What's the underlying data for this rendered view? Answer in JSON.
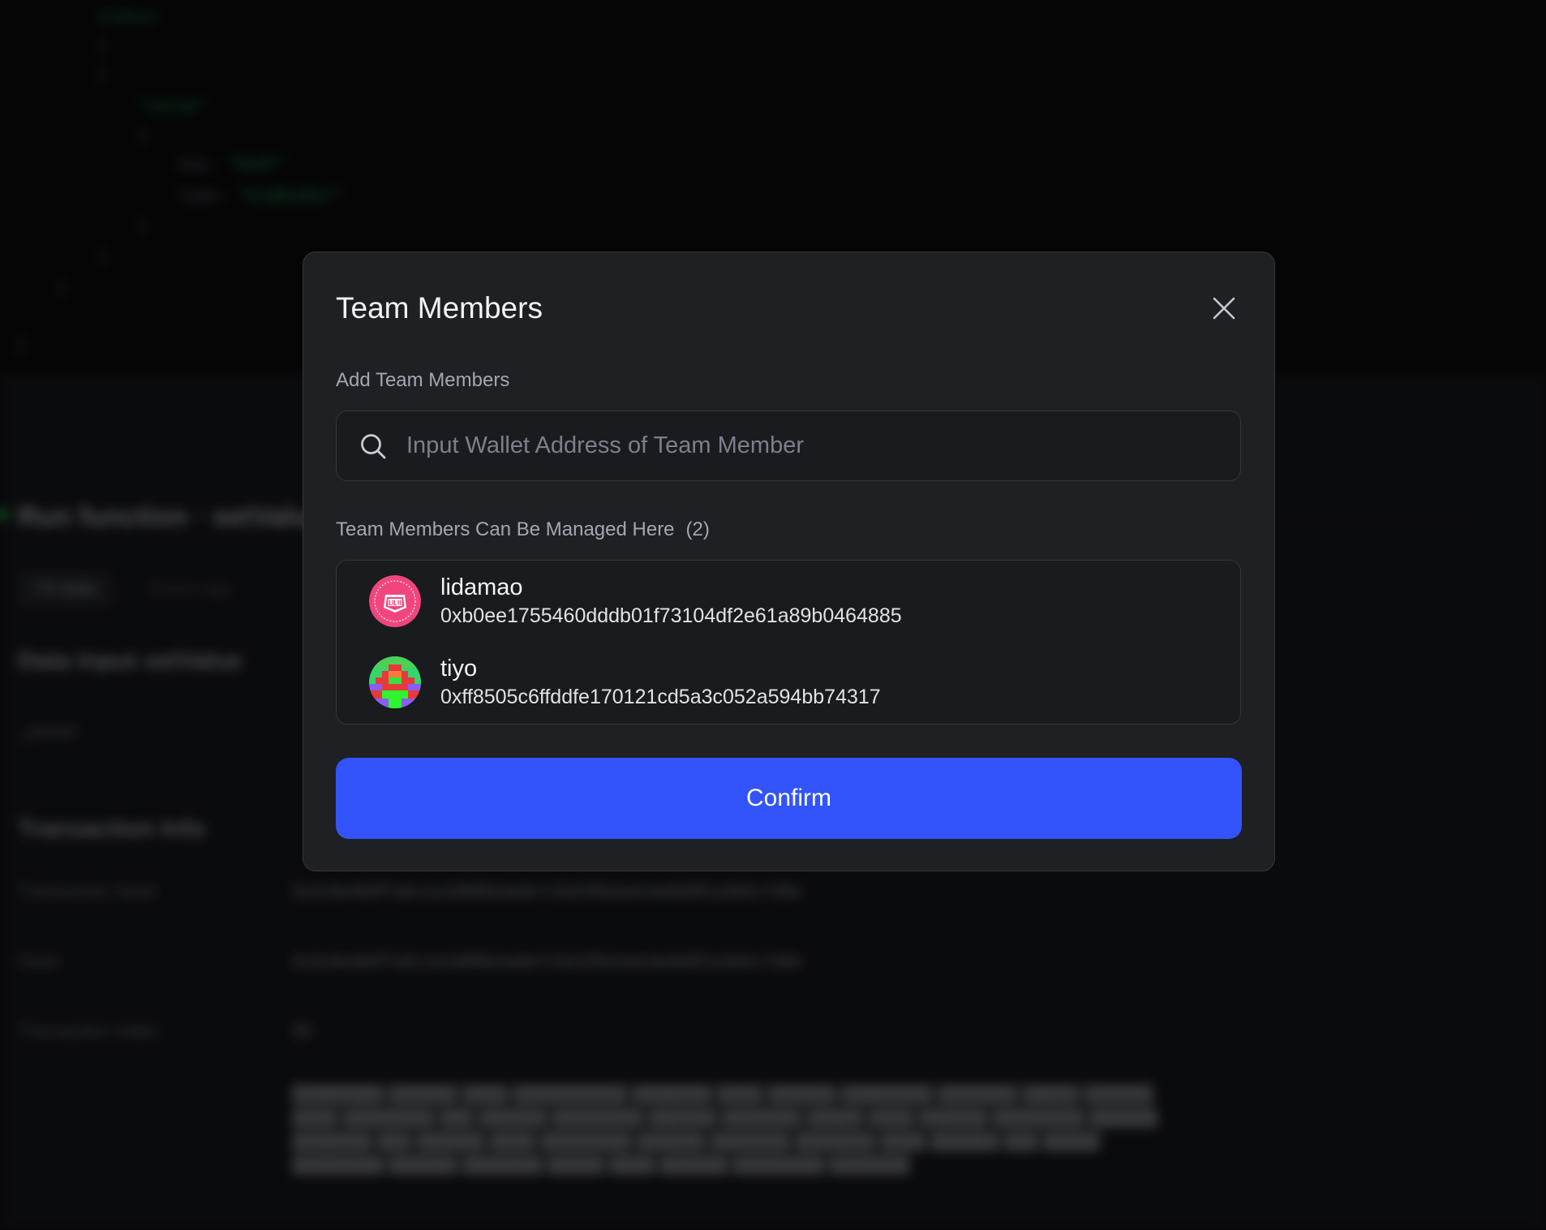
{
  "modal": {
    "title": "Team Members",
    "add_label": "Add Team Members",
    "search_placeholder": "Input Wallet Address of Team Member",
    "search_value": "",
    "manage_label": "Team Members Can Be Managed Here",
    "member_count": "(2)",
    "members": [
      {
        "name": "lidamao",
        "address": "0xb0ee1755460dddb01f73104df2e61a89b0464885",
        "avatar_icon": "buidl-logo-icon"
      },
      {
        "name": "tiyo",
        "address": "0xff8505c6ffddfe170121cd5a3c052a594bb74317",
        "avatar_icon": "pixel-avatar-icon"
      }
    ],
    "confirm_label": "Confirm"
  },
  "colors": {
    "accent": "#3254fa",
    "modal_bg": "#1f2024",
    "overlay_bg": "#0b0b0d",
    "status_green": "#22c55e"
  }
}
